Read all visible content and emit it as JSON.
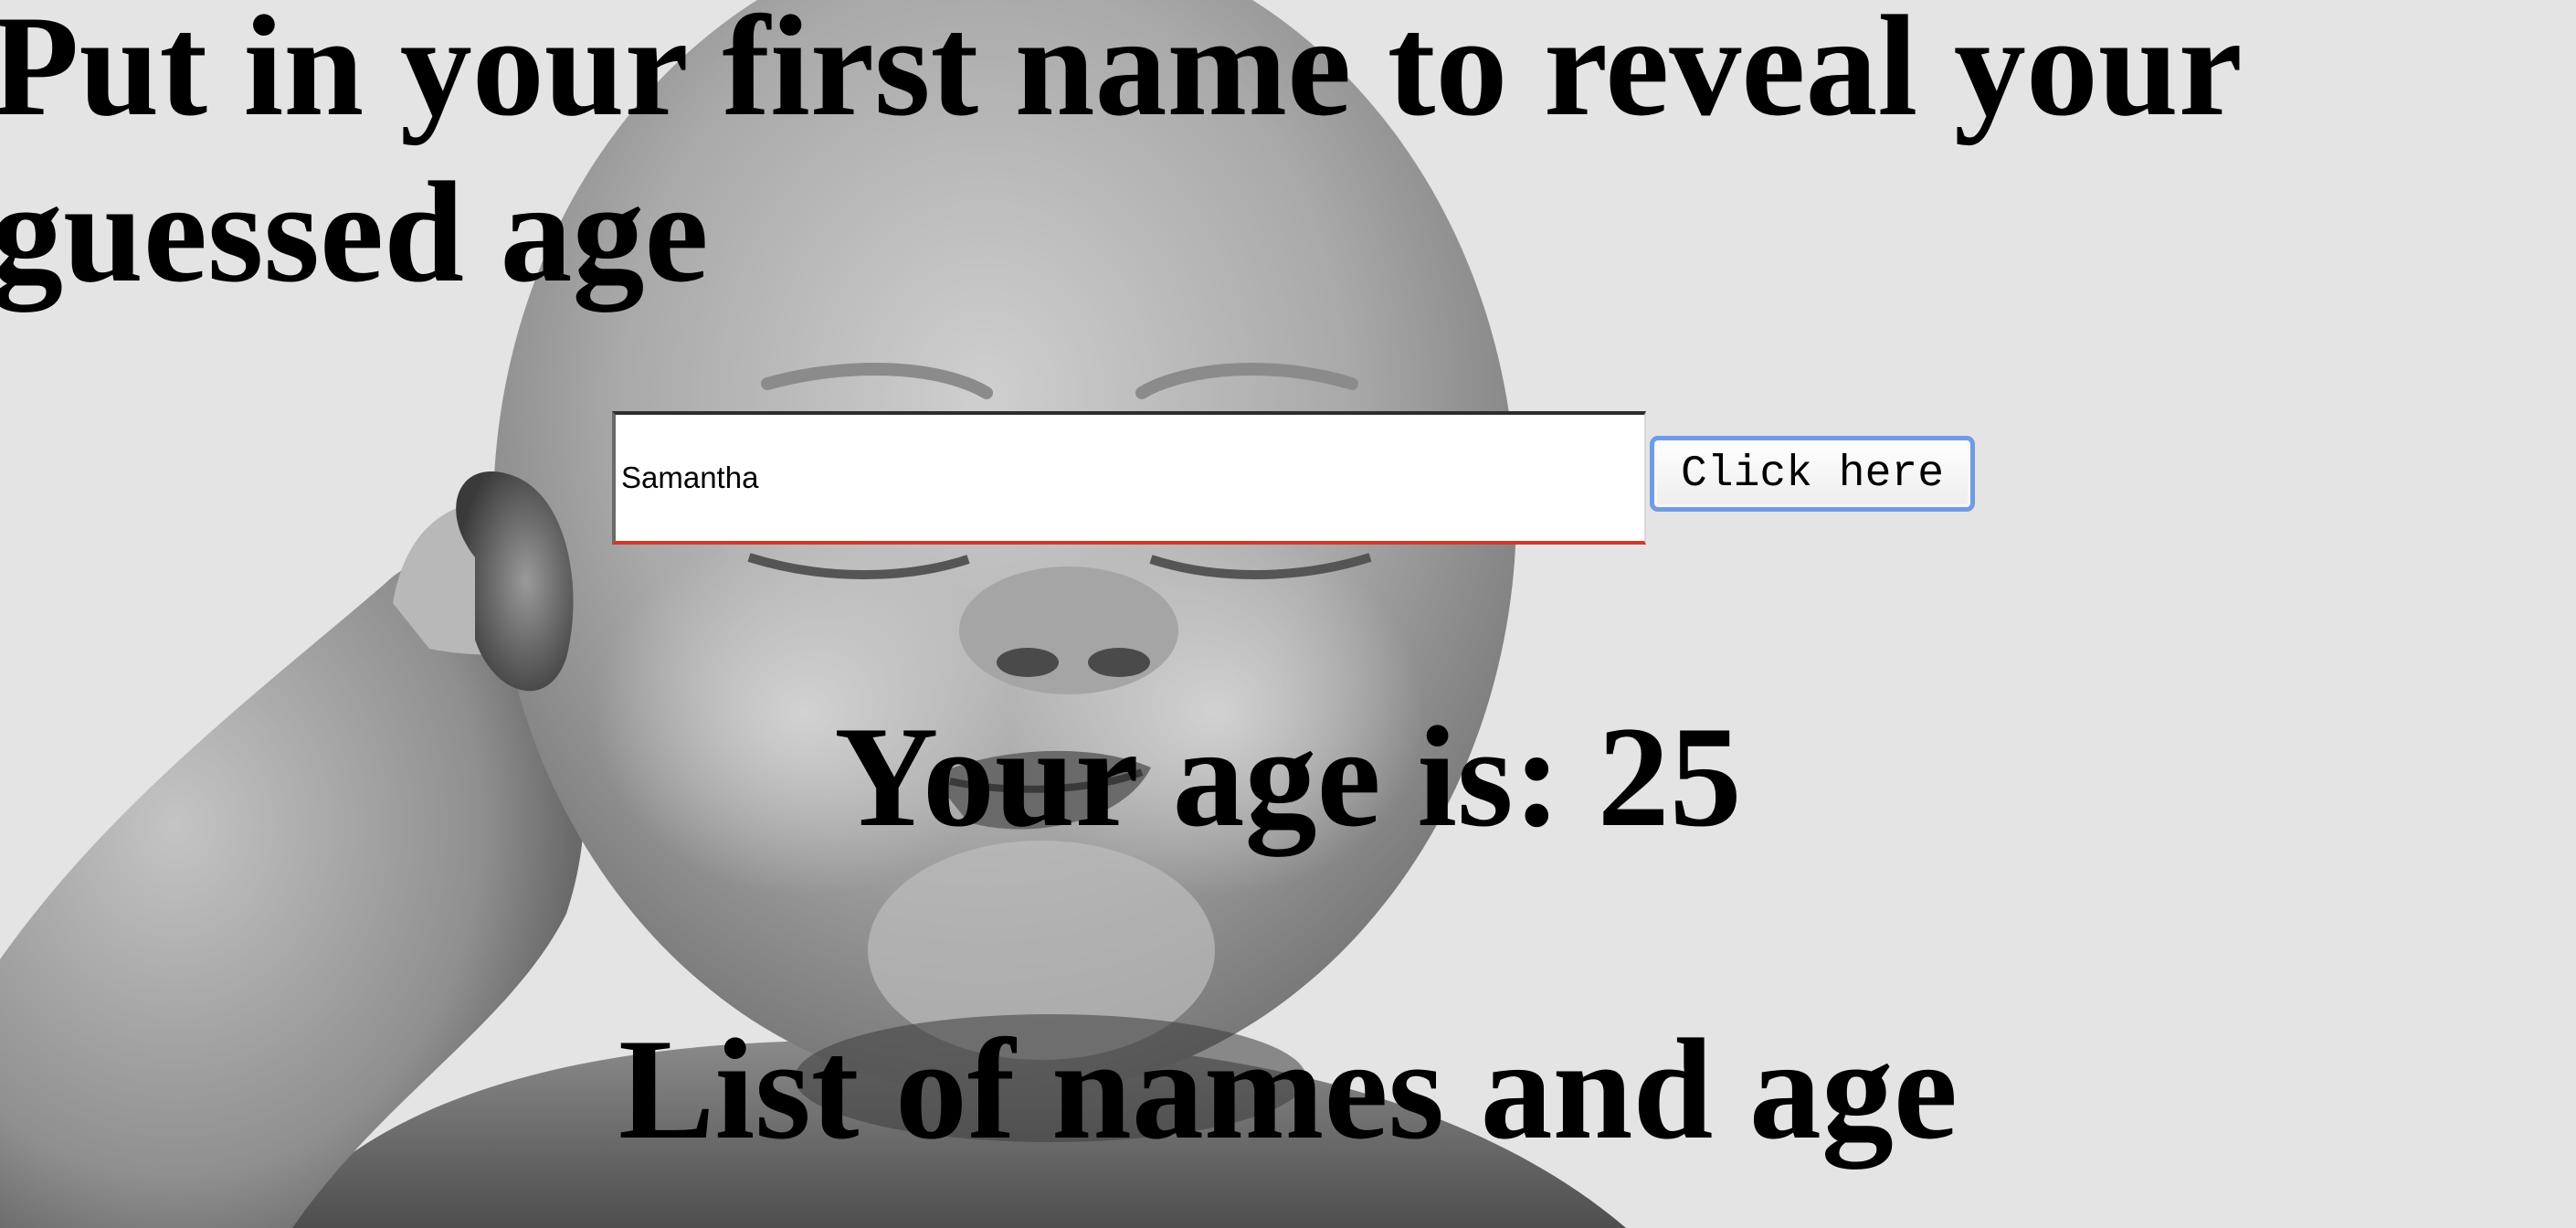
{
  "page": {
    "headline": "Put in your first name to reveal your guessed age",
    "background_image": "baby-photo"
  },
  "form": {
    "name_value": "Samantha",
    "submit_label": "Click here"
  },
  "result": {
    "age_label": "Your age is: ",
    "age_value": "25"
  },
  "list": {
    "heading": "List of names and age"
  },
  "colors": {
    "background": "#e4e4e4",
    "input_bottom_border": "#d6352a",
    "button_focus_ring": "#6f9be6"
  }
}
